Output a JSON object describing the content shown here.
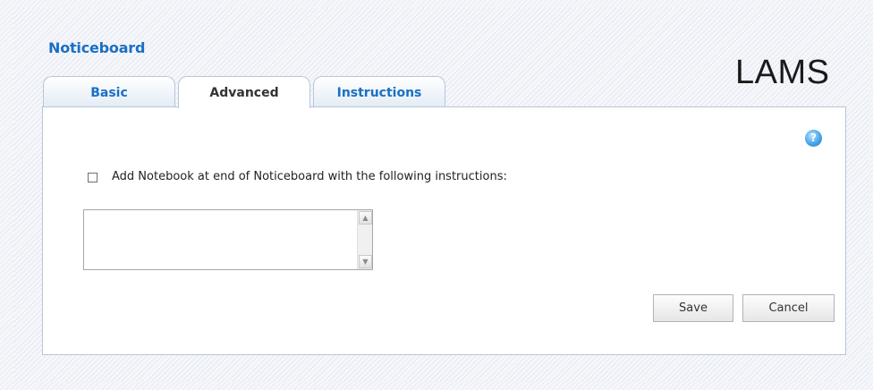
{
  "header": {
    "title": "Noticeboard",
    "logo_text": "LAMS"
  },
  "tabs": [
    {
      "label": "Basic",
      "active": false
    },
    {
      "label": "Advanced",
      "active": true
    },
    {
      "label": "Instructions",
      "active": false
    }
  ],
  "panel": {
    "help_icon": "?",
    "notebook_checkbox": {
      "checked": false,
      "label": "Add Notebook at end of Noticeboard with the following instructions:"
    },
    "instructions_textarea": {
      "value": ""
    },
    "scroll_up_icon": "▲",
    "scroll_down_icon": "▼"
  },
  "buttons": {
    "save_label": "Save",
    "cancel_label": "Cancel"
  },
  "colors": {
    "title": "#1b6fc4",
    "tab_text": "#1b6fc4",
    "help_icon": "#45a6e8"
  }
}
